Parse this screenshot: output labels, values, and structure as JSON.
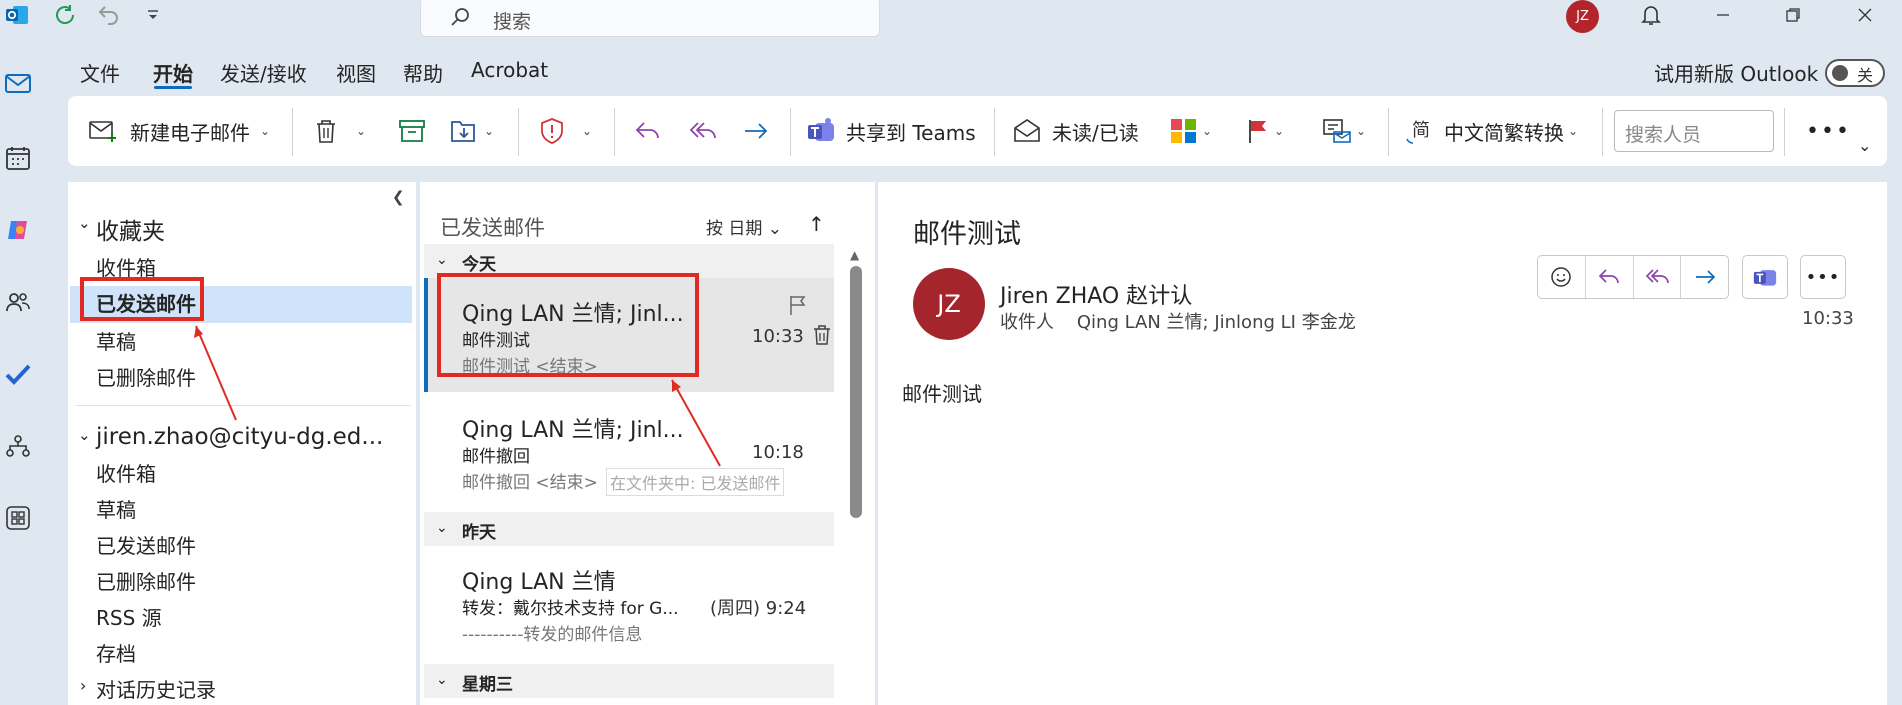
{
  "search": {
    "placeholder": "搜索"
  },
  "user": {
    "initials": "JZ"
  },
  "menu": {
    "tabs": [
      "文件",
      "开始",
      "发送/接收",
      "视图",
      "帮助",
      "Acrobat"
    ],
    "active": "开始"
  },
  "new_outlook": {
    "label": "试用新版 Outlook",
    "toggle": "关"
  },
  "ribbon": {
    "new_email": "新建电子邮件",
    "share_teams": "共享到 Teams",
    "unread_read": "未读/已读",
    "convert": "中文简繁转换",
    "search_people_placeholder": "搜索人员"
  },
  "folders": {
    "favorites_header": "收藏夹",
    "favorites": [
      "收件箱",
      "已发送邮件",
      "草稿",
      "已删除邮件"
    ],
    "account_header": "jiren.zhao@cityu-dg.ed...",
    "account_items": [
      "收件箱",
      "草稿",
      "已发送邮件",
      "已删除邮件",
      "RSS 源",
      "存档"
    ],
    "history": "对话历史记录"
  },
  "list": {
    "title": "已发送邮件",
    "sort": "按 日期",
    "groups": [
      "今天",
      "昨天",
      "星期三"
    ],
    "messages": [
      {
        "from": "Qing LAN 兰情; Jinl...",
        "subject": "邮件测试",
        "preview": "邮件测试 <结束>",
        "time": "10:33"
      },
      {
        "from": "Qing LAN 兰情; Jinl...",
        "subject": "邮件撤回",
        "preview": "邮件撤回 <结束>",
        "time": "10:18"
      },
      {
        "from": "Qing LAN 兰情",
        "subject": "转发：戴尔技术支持 for G...",
        "preview": "----------转发的邮件信息",
        "time": "(周四) 9:24"
      }
    ],
    "tooltip": "在文件夹中: 已发送邮件"
  },
  "reading": {
    "subject": "邮件测试",
    "avatar_initials": "JZ",
    "sender": "Jiren ZHAO 赵计认",
    "recipients_label": "收件人",
    "recipients": "Qing LAN 兰情; Jinlong LI 李金龙",
    "time": "10:33",
    "body": "邮件测试"
  },
  "colors": {
    "accent": "#0f6cbd",
    "highlight_box": "#e02a24",
    "avatar": "#a4262c",
    "reply_purple": "#8e44ad"
  }
}
